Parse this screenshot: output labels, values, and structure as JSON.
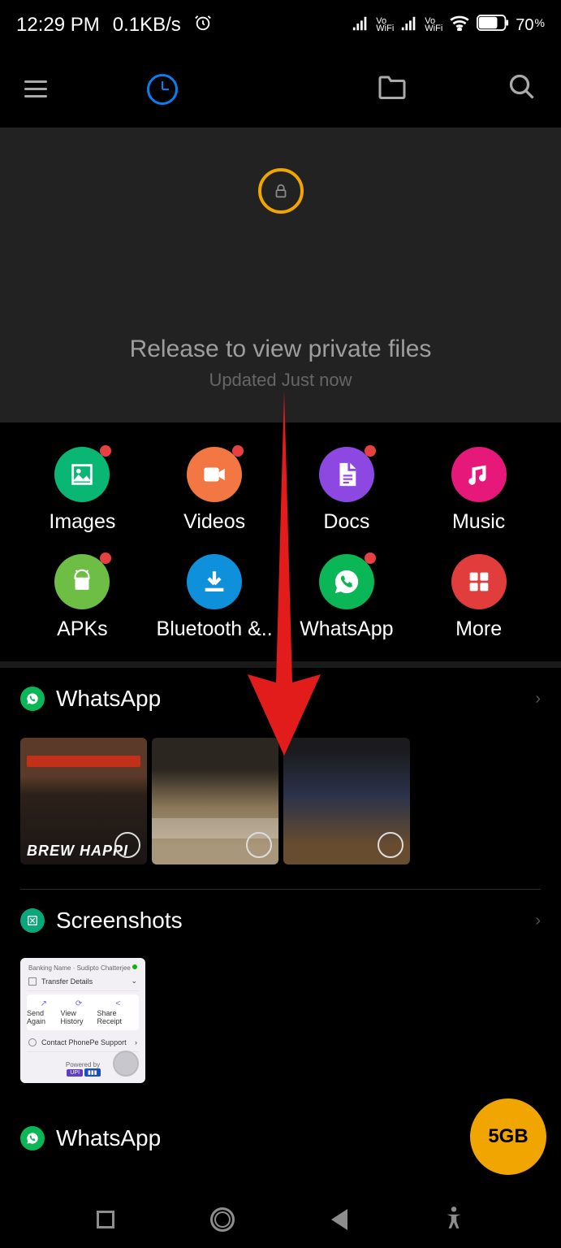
{
  "status": {
    "time": "12:29 PM",
    "speed": "0.1KB/s",
    "indicators": "Vo WiFi signal bars x2, WiFi, alarm",
    "battery": "70",
    "battery_unit": "%"
  },
  "private": {
    "title": "Release to view private files",
    "subtitle": "Updated Just now"
  },
  "categories": [
    {
      "label": "Images",
      "color": "c-green",
      "icon": "image",
      "new": true
    },
    {
      "label": "Videos",
      "color": "c-orange",
      "icon": "video",
      "new": true
    },
    {
      "label": "Docs",
      "color": "c-purple",
      "icon": "doc",
      "new": true
    },
    {
      "label": "Music",
      "color": "c-magenta",
      "icon": "music",
      "new": false
    },
    {
      "label": "APKs",
      "color": "c-lgreen",
      "icon": "android",
      "new": true
    },
    {
      "label": "Bluetooth &..",
      "color": "c-blue",
      "icon": "download",
      "new": false
    },
    {
      "label": "WhatsApp",
      "color": "c-wgreen",
      "icon": "whatsapp",
      "new": true
    },
    {
      "label": "More",
      "color": "c-red",
      "icon": "more",
      "new": false
    }
  ],
  "sections": {
    "whatsapp": {
      "title": "WhatsApp",
      "icon_color": "#0bb656",
      "thumbs": 3,
      "brew_text": "BREW HAPPI"
    },
    "screenshots": {
      "title": "Screenshots",
      "icon_color": "#09a77a",
      "thumb": {
        "header": "Banking Name · Sudipto Chatterjee",
        "row1": "Transfer Details",
        "actions": [
          "Send Again",
          "View History",
          "Share Receipt"
        ],
        "support": "Contact PhonePe Support",
        "powered": "Powered by",
        "chip": "UPI"
      }
    },
    "whatsapp2": {
      "title": "WhatsApp",
      "icon_color": "#0bb656"
    }
  },
  "fab": {
    "label": "5GB"
  }
}
